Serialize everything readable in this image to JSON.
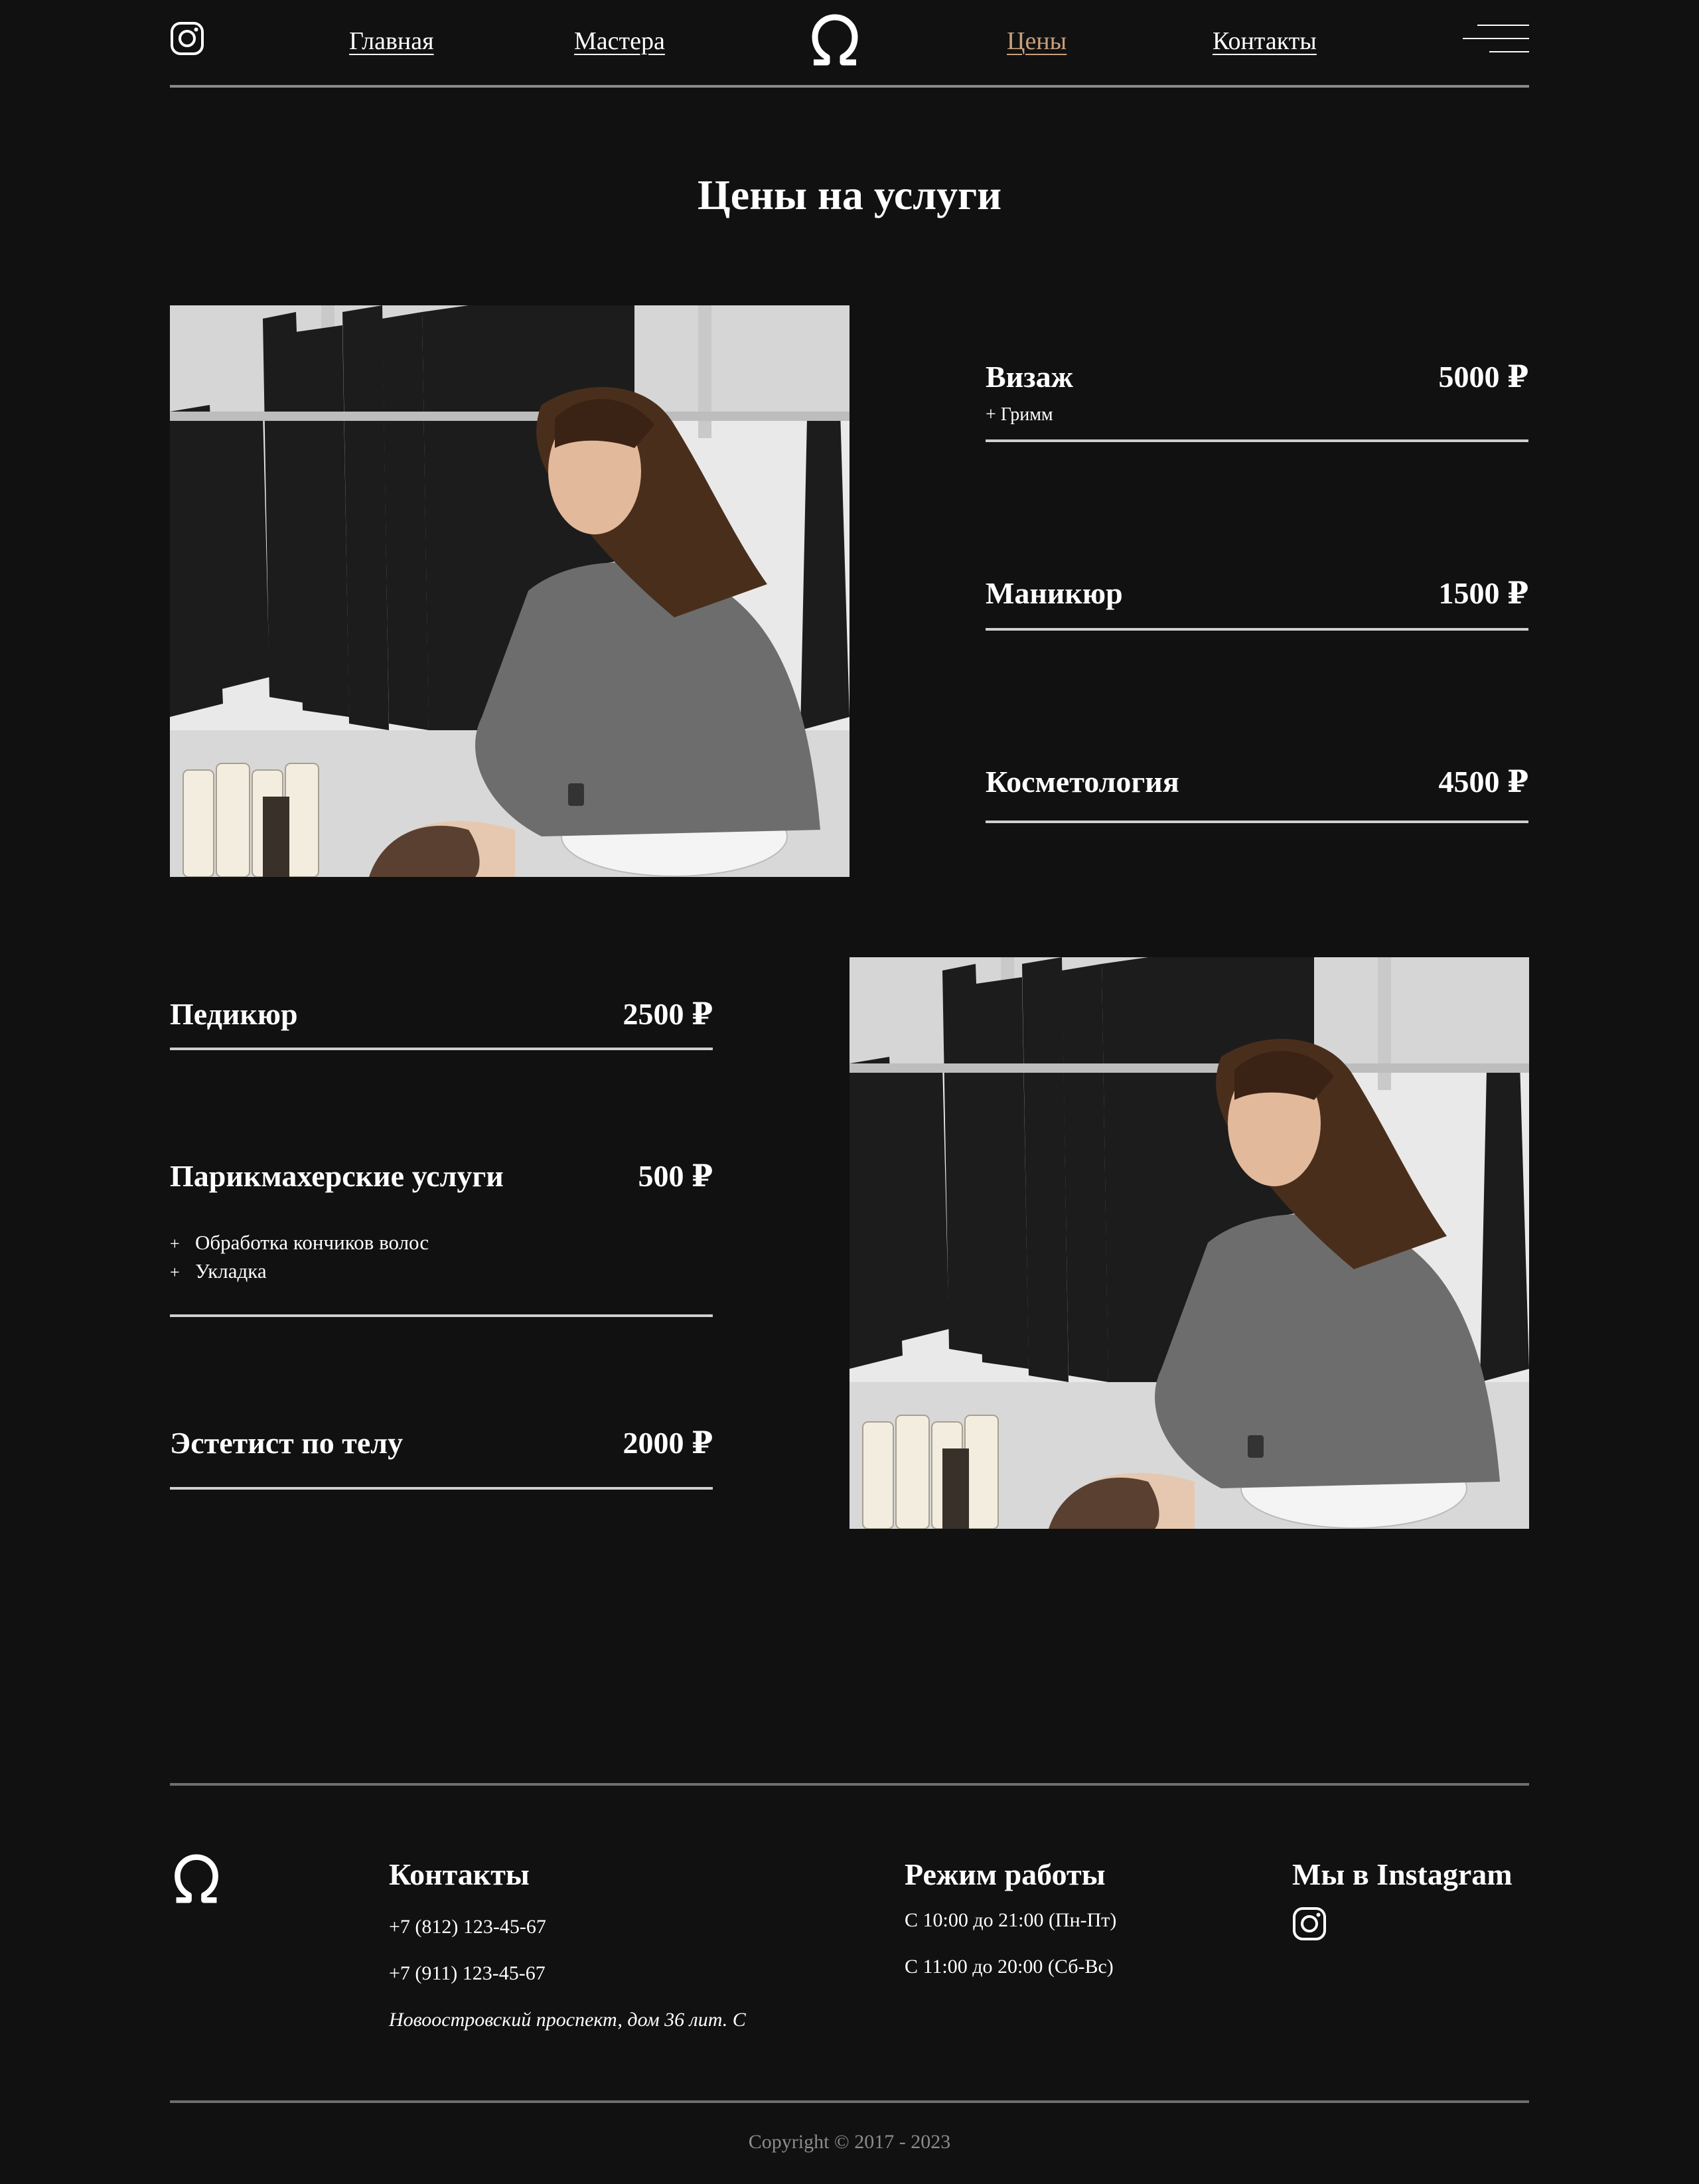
{
  "colors": {
    "background": "#111111",
    "text": "#ffffff",
    "accent": "#c8a07e",
    "divider": "#8a8a8a"
  },
  "icons": {
    "instagram": "instagram-icon",
    "logo": "omega-logo-icon",
    "menu": "hamburger-menu-icon"
  },
  "header": {
    "nav": {
      "home": "Главная",
      "masters": "Мастера",
      "prices": "Цены",
      "contacts": "Контакты"
    },
    "active_item": "prices"
  },
  "main": {
    "title": "Цены на услуги",
    "services": [
      {
        "name": "Визаж",
        "price": "5000 ₽",
        "note": "+ Гримм"
      },
      {
        "name": "Маникюр",
        "price": "1500 ₽"
      },
      {
        "name": "Косметология",
        "price": "4500 ₽"
      },
      {
        "name": "Педикюр",
        "price": "2500 ₽"
      },
      {
        "name": "Парикмахерские услуги",
        "price": "500 ₽",
        "subitems": [
          "Обработка кончиков волос",
          "Укладка"
        ]
      },
      {
        "name": "Эстетист по телу",
        "price": "2000 ₽"
      }
    ]
  },
  "footer": {
    "contacts": {
      "heading": "Контакты",
      "phone1": "+7 (812) 123-45-67",
      "phone2": "+7 (911) 123-45-67",
      "address": "Новоостровский проспект, дом 36 лит. С"
    },
    "hours": {
      "heading": "Режим работы",
      "weekdays": "С 10:00 до 21:00 (Пн-Пт)",
      "weekend": "С 11:00 до 20:00 (Сб-Вс)"
    },
    "instagram": {
      "heading": "Мы в Instagram"
    },
    "copyright": "Copyright © 2017 - 2023"
  }
}
